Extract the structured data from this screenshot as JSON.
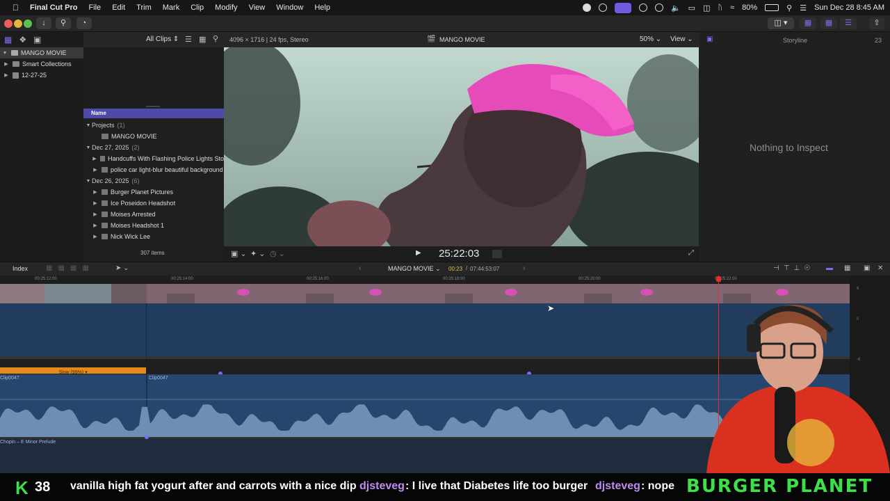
{
  "menubar": {
    "app_name": "Final Cut Pro",
    "items": [
      "File",
      "Edit",
      "Trim",
      "Mark",
      "Clip",
      "Modify",
      "View",
      "Window",
      "Help"
    ],
    "battery": "80%",
    "clock": "Sun Dec 28  8:45 AM"
  },
  "library": {
    "items": [
      {
        "label": "MANGO MOVIE"
      },
      {
        "label": "Smart Collections"
      },
      {
        "label": "12-27-25"
      }
    ]
  },
  "browser": {
    "filter": "All Clips",
    "column_name": "Name",
    "item_count": "307 items",
    "groups": [
      {
        "label": "Projects",
        "count": "(1)",
        "items": [
          "MANGO MOVIE"
        ]
      },
      {
        "label": "Dec 27, 2025",
        "count": "(2)",
        "items": [
          "Handcuffs With Flashing Police Lights Sto",
          "police car light-blur beautiful background"
        ]
      },
      {
        "label": "Dec 26, 2025",
        "count": "(6)",
        "items": [
          "Burger Planet Pictures",
          "Ice Poseidon Headshot",
          "Moises Arrested",
          "Moises Headshot 1",
          "Nick Wick Lee"
        ]
      }
    ]
  },
  "viewer": {
    "format_info": "4096 × 1716 | 24 fps, Stereo",
    "project_title": "MANGO MOVIE",
    "zoom": "50%",
    "view_menu": "View",
    "timecode": "25:22:03"
  },
  "inspector": {
    "mode": "Storyline",
    "timecode": "23",
    "empty_message": "Nothing to Inspect"
  },
  "timeline": {
    "index_label": "Index",
    "project_title": "MANGO MOVIE",
    "position": "00:23",
    "duration": "07:44:53:07",
    "ruler_ticks": [
      "00:25:12:00",
      "00:25:14:00",
      "00:25:16:00",
      "00:25:18:00",
      "00:25:20:00",
      "00:25:22:00"
    ],
    "retime_label": "Slow (99%) ▾",
    "clip_name_1": "Clip0047",
    "clip_name_2": "Clip0047",
    "music_clip": "Chopin – E Minor Prelude"
  },
  "chatbar": {
    "k_label": "K",
    "k_count": "38",
    "message_1": "vanilla high fat yogurt after and carrots with a nice dip",
    "user_2": "djsteveg",
    "message_2": ": I live that Diabetes life too burger",
    "user_3": "djsteveg",
    "message_3": ": nope",
    "brand": "BURGER PLANET"
  },
  "colors": {
    "accent": "#6f5ce0",
    "browser_header": "#4f4aa7",
    "retime_bar": "#e38a1a",
    "playhead": "#e03030",
    "chat_user": "#c08cf0",
    "brand_green": "#3ee04a"
  }
}
